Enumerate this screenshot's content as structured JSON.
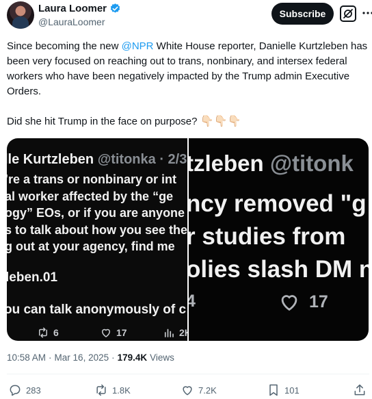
{
  "author": {
    "name": "Laura Loomer",
    "handle": "@LauraLoomer"
  },
  "header": {
    "subscribe_label": "Subscribe"
  },
  "tweet": {
    "line1_before": "Since becoming the new ",
    "mention": "@NPR",
    "line1_after": " White House reporter, Danielle Kurtzleben has been very focused on reaching out to trans, nonbinary, and intersex federal workers who have been negatively impacted by the Trump admin Executive Orders.",
    "line2": "Did she hit Trump in the face on purpose?",
    "emoji": "👇🏻👇🏻👇🏻"
  },
  "media": {
    "left": {
      "title_name": "lle Kurtzleben",
      "title_handle": "@titonka · 2/3",
      "body_lines": [
        "’re a trans or nonbinary or int",
        "al worker affected by the “ge",
        "ogy” EOs, or if you are anyone",
        "s to talk about how you see the",
        "g out at your agency, find me"
      ],
      "handle_line": "leben.01",
      "anon_line": "ou can talk anonymously of c",
      "retweets": "6",
      "likes": "17",
      "views": "2K"
    },
    "right": {
      "title_name": "tzleben",
      "title_handle": "@titonk",
      "body_lines": [
        "ncy removed \"g",
        "r studies from",
        "olies slash DM n"
      ],
      "number": "4",
      "likes": "17"
    }
  },
  "meta": {
    "time": "10:58 AM",
    "separator": "·",
    "date": "Mar 16, 2025",
    "separator2": "·",
    "views_count": "179.4K",
    "views_label": "Views"
  },
  "actions": {
    "replies": "283",
    "reposts": "1.8K",
    "likes": "7.2K",
    "bookmarks": "101"
  },
  "colors": {
    "accent": "#1d9bf0",
    "text": "#0f1419",
    "muted": "#536471"
  }
}
